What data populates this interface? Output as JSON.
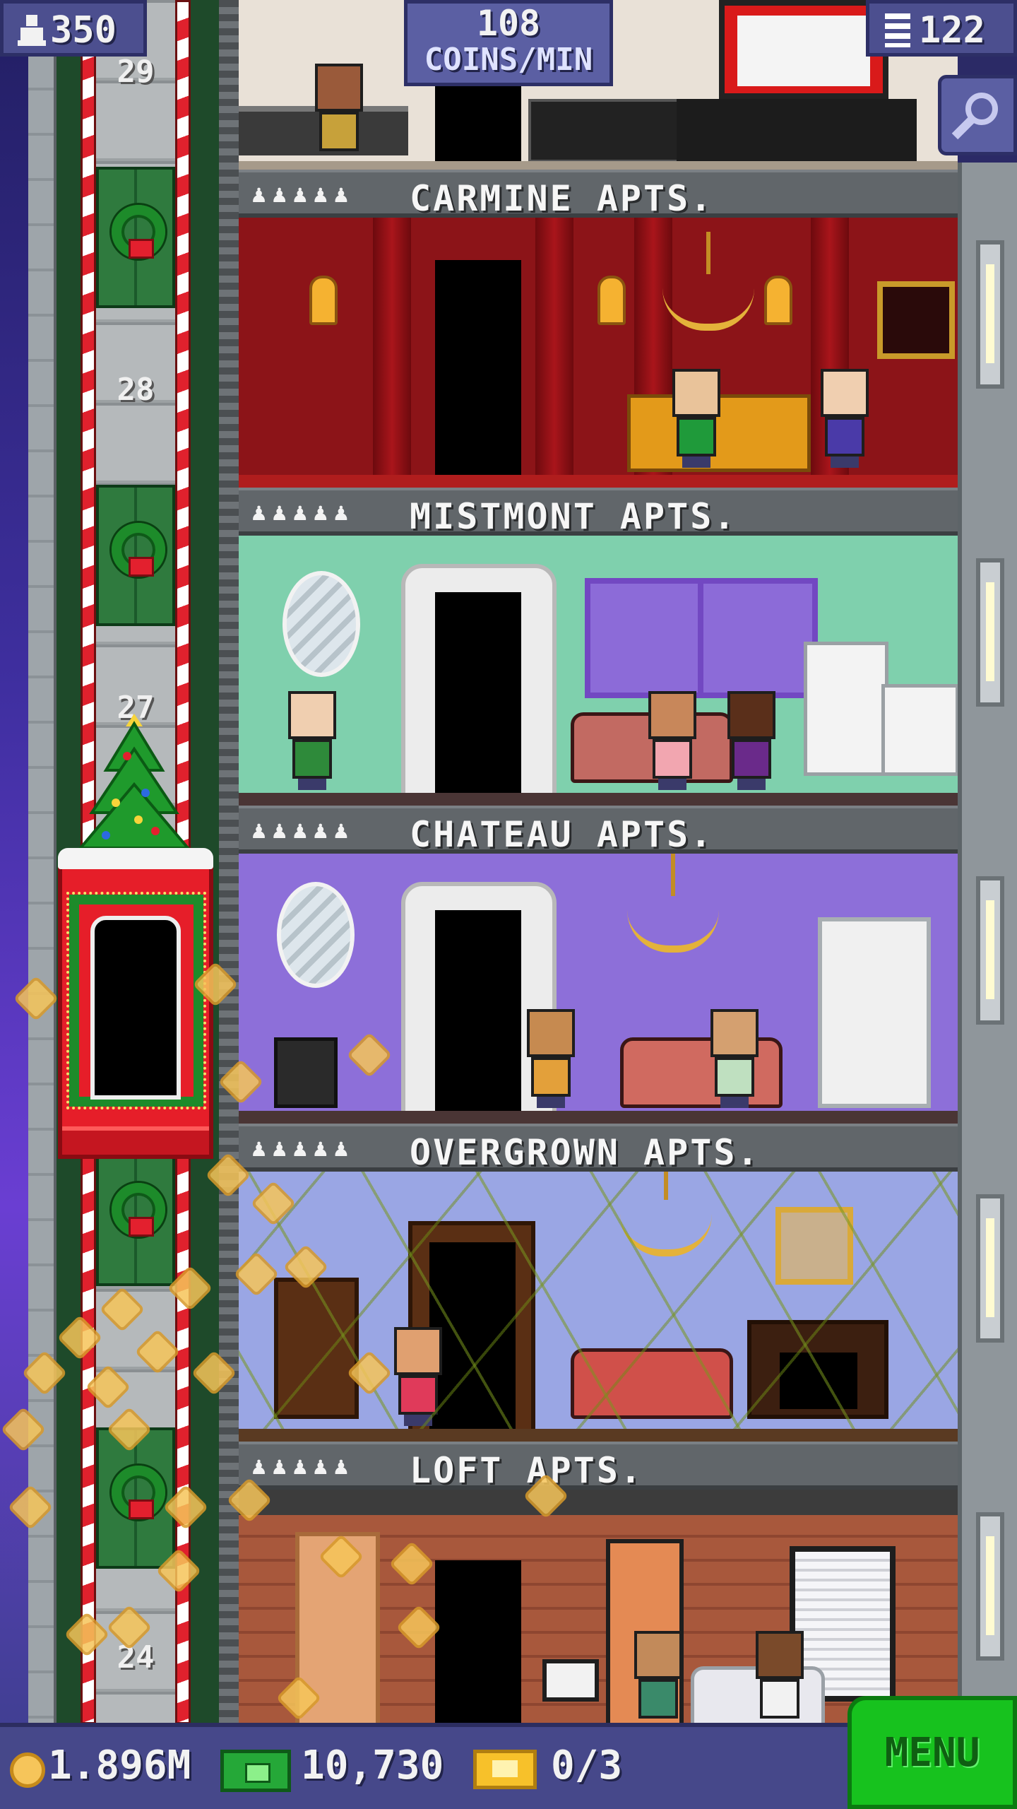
{
  "hud": {
    "population": "350",
    "coins_per_min_value": "108",
    "coins_per_min_unit": "COINS/MIN",
    "floors": "122"
  },
  "shaft": {
    "floor_numbers": [
      "29",
      "28",
      "27",
      "24"
    ]
  },
  "floors": [
    {
      "name": "CARMINE APTS.",
      "stars": "♟♟♟♟♟",
      "wall": "#8c1418",
      "floor_color": "#b01d1d"
    },
    {
      "name": "MISTMONT APTS.",
      "stars": "♟♟♟♟♟",
      "wall": "#7fd0ad",
      "floor_color": "#4a3535"
    },
    {
      "name": "CHATEAU APTS.",
      "stars": "♟♟♟♟♟",
      "wall": "#8d6fd9",
      "floor_color": "#4a3535"
    },
    {
      "name": "OVERGROWN APTS.",
      "stars": "♟♟♟♟♟",
      "wall": "#9aa6e4",
      "floor_color": "#5a3a22"
    },
    {
      "name": "LOFT APTS.",
      "stars": "♟♟♟♟♟",
      "wall": "#a8583c",
      "floor_color": "#3a2a22"
    }
  ],
  "bottom_bar": {
    "coins": "1.896M",
    "bux": "10,730",
    "tickets": "0/3",
    "menu_label": "MENU"
  },
  "colors": {
    "hud_bg": "#4c4f8f",
    "menu_green": "#17c21e",
    "coin_gold": "#f6c55a"
  },
  "icons": [
    "person-icon",
    "building-icon",
    "zoom-icon",
    "coin-icon",
    "bux-icon",
    "ticket-icon",
    "wreath-icon",
    "christmas-tree-icon"
  ]
}
